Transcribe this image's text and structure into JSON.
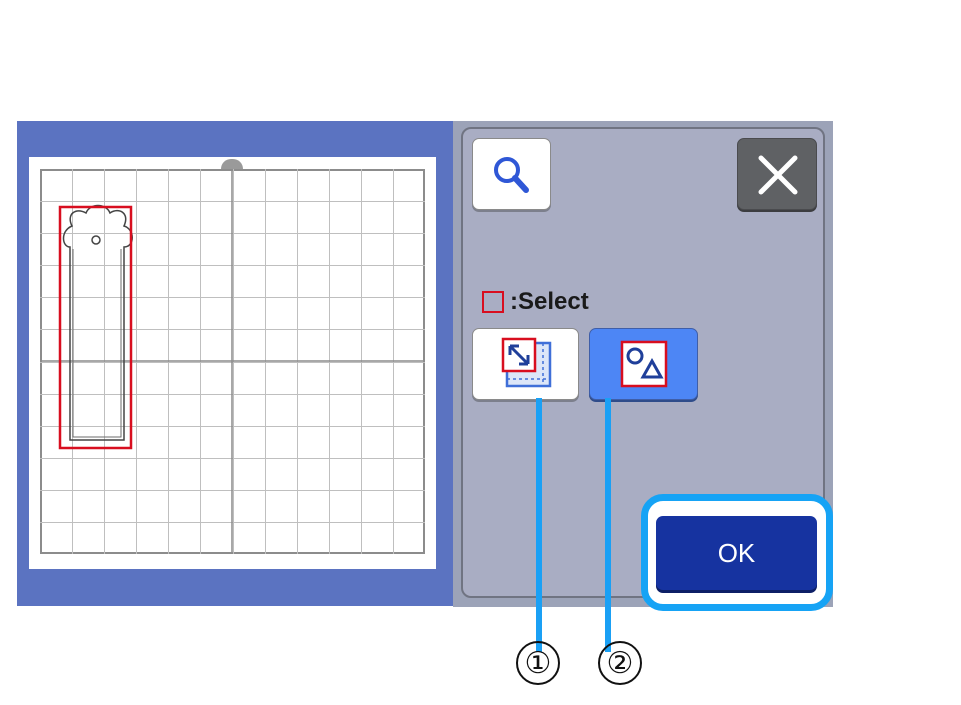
{
  "toolbar": {
    "zoom_icon": "magnifier-icon",
    "close_icon": "close-icon"
  },
  "legend": {
    "select_label": ":Select",
    "select_color": "#d80e1f"
  },
  "mode_buttons": {
    "area_select_icon": "select-area-icon",
    "shape_select_icon": "select-shape-icon",
    "active": "shape_select"
  },
  "actions": {
    "ok_label": "OK"
  },
  "callouts": {
    "one": "①",
    "two": "②"
  },
  "colors": {
    "accent": "#4d86f5",
    "ok_button": "#1633a0",
    "highlight": "#16a3f5",
    "mat_border": "#5b73c1"
  }
}
